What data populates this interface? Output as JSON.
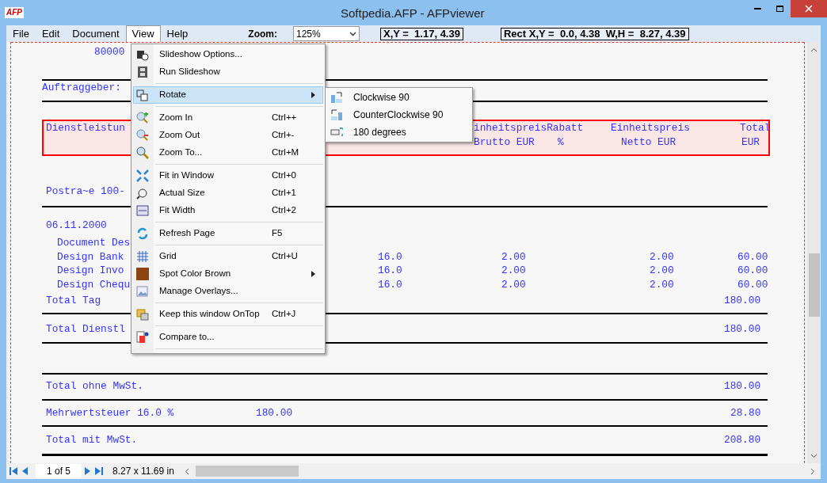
{
  "window": {
    "title": "Softpedia.AFP  -  AFPviewer",
    "app_badge": "AFP"
  },
  "menu_bar": [
    {
      "label": "File",
      "selected": false
    },
    {
      "label": "Edit",
      "selected": false
    },
    {
      "label": "Document",
      "selected": false
    },
    {
      "label": "View",
      "selected": true
    },
    {
      "label": "Help",
      "selected": false
    }
  ],
  "zoom": {
    "label": "Zoom:",
    "value": "125%"
  },
  "coords": {
    "xy": "X,Y =  1.17, 4.39",
    "rect": "Rect X,Y =  0.0, 4.38  W,H =  8.27, 4.39"
  },
  "view_menu": [
    {
      "kind": "item",
      "label": "Slideshow Options...",
      "selected": false,
      "has_submenu": false
    },
    {
      "kind": "item",
      "label": "Run Slideshow",
      "selected": false,
      "has_submenu": false
    },
    {
      "kind": "separator"
    },
    {
      "kind": "item",
      "label": "Rotate",
      "selected": true,
      "has_submenu": true
    },
    {
      "kind": "separator"
    },
    {
      "kind": "item",
      "label": "Zoom In",
      "shortcut": "Ctrl++",
      "selected": false,
      "has_submenu": false
    },
    {
      "kind": "item",
      "label": "Zoom Out",
      "shortcut": "Ctrl+-",
      "selected": false,
      "has_submenu": false
    },
    {
      "kind": "item",
      "label": "Zoom To...",
      "shortcut": "Ctrl+M",
      "selected": false,
      "has_submenu": false
    },
    {
      "kind": "separator"
    },
    {
      "kind": "item",
      "label": "Fit in Window",
      "shortcut": "Ctrl+0",
      "selected": false,
      "has_submenu": false
    },
    {
      "kind": "item",
      "label": "Actual Size",
      "shortcut": "Ctrl+1",
      "selected": false,
      "has_submenu": false
    },
    {
      "kind": "item",
      "label": "Fit Width",
      "shortcut": "Ctrl+2",
      "selected": false,
      "has_submenu": false
    },
    {
      "kind": "separator"
    },
    {
      "kind": "item",
      "label": "Refresh Page",
      "shortcut": "F5",
      "selected": false,
      "has_submenu": false
    },
    {
      "kind": "separator"
    },
    {
      "kind": "item",
      "label": "Grid",
      "shortcut": "Ctrl+U",
      "selected": false,
      "has_submenu": false
    },
    {
      "kind": "item",
      "label": "Spot Color Brown",
      "selected": false,
      "has_submenu": true
    },
    {
      "kind": "item",
      "label": "Manage Overlays...",
      "selected": false,
      "has_submenu": false
    },
    {
      "kind": "separator"
    },
    {
      "kind": "item",
      "label": "Keep this window OnTop",
      "shortcut": "Ctrl+J",
      "selected": false,
      "has_submenu": false
    },
    {
      "kind": "separator"
    },
    {
      "kind": "item",
      "label": "Compare to...",
      "selected": false,
      "has_submenu": false
    },
    {
      "kind": "separator"
    }
  ],
  "rotate_submenu": [
    "Clockwise 90",
    "CounterClockwise 90",
    "180 degrees"
  ],
  "document": {
    "texts": [
      "80000",
      "Auftraggeber:",
      "Dienstleistun",
      "inheitspreisRabatt",
      "Einheitspreis",
      "Total",
      "Brutto EUR",
      "%",
      "Netto EUR",
      "EUR",
      "Postra~e 100-",
      "06.11.2000",
      "Document Des",
      "Design Bank",
      "16.0",
      "2.00",
      "2.00",
      "60.00",
      "Design Invo",
      "16.0",
      "2.00",
      "2.00",
      "60.00",
      "Design Chequ",
      "16.0",
      "2.00",
      "2.00",
      "60.00",
      "Total Tag",
      "180.00",
      "Total Dienstl",
      "180.00",
      "Total ohne MwSt.",
      "180.00",
      "Mehrwertsteuer 16.0 %",
      "180.00",
      "28.80",
      "Total mit MwSt.",
      "208.80"
    ]
  },
  "status_bar": {
    "page": "1 of 5",
    "size": "8.27 x 11.69 in"
  }
}
